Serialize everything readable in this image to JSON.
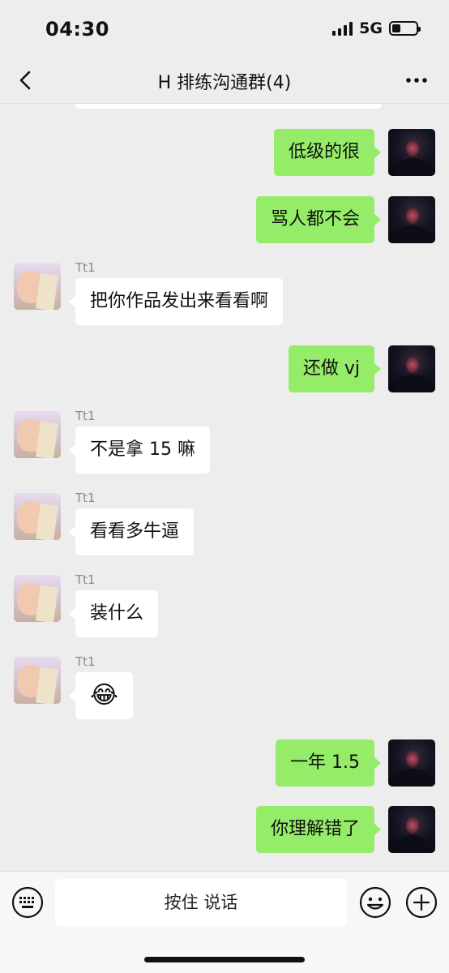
{
  "status_bar": {
    "time": "04:30",
    "network": "5G",
    "battery_level": 0.35
  },
  "header": {
    "title": "H 排练沟通群(4)",
    "back_icon": "chevron-left-icon",
    "more_icon": "more-dots-icon"
  },
  "messages": [
    {
      "from": "me",
      "text": "低级的很"
    },
    {
      "from": "me",
      "text": "骂人都不会"
    },
    {
      "from": "other",
      "sender": "Tt1",
      "text": "把你作品发出来看看啊"
    },
    {
      "from": "me",
      "text": "还做 vj"
    },
    {
      "from": "other",
      "sender": "Tt1",
      "text": "不是拿 15 嘛"
    },
    {
      "from": "other",
      "sender": "Tt1",
      "text": "看看多牛逼"
    },
    {
      "from": "other",
      "sender": "Tt1",
      "text": "装什么"
    },
    {
      "from": "other",
      "sender": "Tt1",
      "text": "😂"
    },
    {
      "from": "me",
      "text": "一年 1.5"
    },
    {
      "from": "me",
      "text": "你理解错了"
    }
  ],
  "input_bar": {
    "hold_to_talk_label": "按住 说话",
    "keyboard_icon": "keyboard-icon",
    "emoji_icon": "emoji-icon",
    "plus_icon": "plus-icon"
  }
}
